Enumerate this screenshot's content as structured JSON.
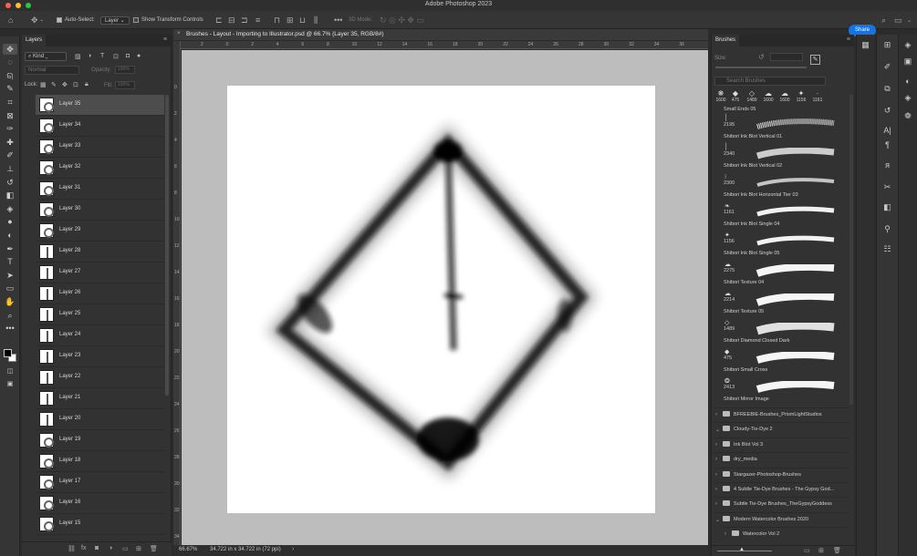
{
  "app": {
    "title": "Adobe Photoshop 2023"
  },
  "options_bar": {
    "auto_select_label": "Auto-Select:",
    "auto_select_target": "Layer",
    "show_transform_label": "Show Transform Controls",
    "mode_3d": "3D Mode:",
    "share_label": "Share"
  },
  "document": {
    "tab_title": "Brushes - Layout - Importing to Illustrator.psd @ 66.7% (Layer 35, RGB/8#)",
    "ruler_top": [
      "2",
      "0",
      "2",
      "4",
      "6",
      "8",
      "10",
      "12",
      "14",
      "16",
      "18",
      "20",
      "22",
      "24",
      "26",
      "28",
      "30",
      "32",
      "34",
      "36"
    ],
    "ruler_left": [
      "0",
      "2",
      "4",
      "6",
      "8",
      "10",
      "12",
      "14",
      "16",
      "18",
      "20",
      "22",
      "24",
      "26",
      "28",
      "30",
      "32",
      "34"
    ],
    "status_zoom": "66.67%",
    "status_size": "34.722 in x 34.722 in (72 ppi)"
  },
  "layers_panel": {
    "tab_label": "Layers",
    "kind_label": "Kind",
    "blend_mode": "Normal",
    "opacity_label": "Opacity:",
    "opacity_value": "100%",
    "lock_label": "Lock:",
    "fill_label": "Fill:",
    "fill_value": "100%",
    "layers": [
      {
        "name": "Layer 35",
        "selected": true
      },
      {
        "name": "Layer 34"
      },
      {
        "name": "Layer 33"
      },
      {
        "name": "Layer 32"
      },
      {
        "name": "Layer 31"
      },
      {
        "name": "Layer 30"
      },
      {
        "name": "Layer 29"
      },
      {
        "name": "Layer 28"
      },
      {
        "name": "Layer 27"
      },
      {
        "name": "Layer 26"
      },
      {
        "name": "Layer 25"
      },
      {
        "name": "Layer 24"
      },
      {
        "name": "Layer 23"
      },
      {
        "name": "Layer 22"
      },
      {
        "name": "Layer 21"
      },
      {
        "name": "Layer 20"
      },
      {
        "name": "Layer 19"
      },
      {
        "name": "Layer 18"
      },
      {
        "name": "Layer 17"
      },
      {
        "name": "Layer 16"
      },
      {
        "name": "Layer 15"
      }
    ]
  },
  "brushes_panel": {
    "tab_label": "Brushes",
    "size_label": "Size:",
    "search_placeholder": "Search Brushes",
    "recent": [
      {
        "glyph": "❋",
        "size": "1600"
      },
      {
        "glyph": "◆",
        "size": "475"
      },
      {
        "glyph": "◇",
        "size": "1489"
      },
      {
        "glyph": "☁",
        "size": "1600"
      },
      {
        "glyph": "☁",
        "size": "1600"
      },
      {
        "glyph": "✦",
        "size": "1156"
      },
      {
        "glyph": "·",
        "size": "1161"
      }
    ],
    "top_partial": "Small Ends 05",
    "brushes": [
      {
        "size": "2195",
        "name": "Shibori Ink Blot Vertical 01"
      },
      {
        "size": "2340",
        "name": "Shibori Ink Blot Vertical 02"
      },
      {
        "size": "2300",
        "name": "Shibori Ink Blot Horizontal Tier 03"
      },
      {
        "size": "1161",
        "name": "Shibori Ink Blot Single 04"
      },
      {
        "size": "1156",
        "name": "Shibori Ink Blot Single 05"
      },
      {
        "size": "2275",
        "name": "Shibori Texture 04"
      },
      {
        "size": "2214",
        "name": "Shibori Texture 05"
      },
      {
        "size": "1489",
        "name": "Shibori Diamond Closed Dark"
      },
      {
        "size": "475",
        "name": "Shibori Small Cross"
      },
      {
        "size": "2413",
        "name": "Shibori Mirror Image"
      }
    ],
    "groups": [
      {
        "name": "BFREEBIE-Brushes_PrismLightStudios",
        "open": false
      },
      {
        "name": "Cloudy-Tie-Dye 2",
        "open": true
      },
      {
        "name": "Ink Blot Vol 3",
        "open": false
      },
      {
        "name": "dry_media",
        "open": false
      },
      {
        "name": "Stargazer-Photoshop-Brushes",
        "open": false
      },
      {
        "name": "4 Subtle Tie-Dye Brushes - The Gypsy God...",
        "open": false
      },
      {
        "name": "Subtle Tie-Dye Brushes_TheGypsyGoddess",
        "open": false
      },
      {
        "name": "Modern Watercolor Brushes 2020",
        "open": true
      },
      {
        "name": "Watercolor Vol 2",
        "open": false,
        "sub": true
      }
    ]
  },
  "colors": {
    "accent": "#1473e6",
    "canvas_bg": "#bdbdbd",
    "panel_bg": "#323232"
  }
}
